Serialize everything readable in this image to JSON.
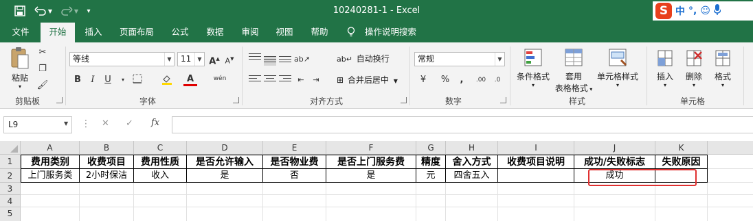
{
  "window": {
    "title": "10240281-1  -  Excel",
    "quick_access": {
      "save_icon": "save-icon",
      "undo_icon": "undo-icon",
      "redo_icon": "redo-icon",
      "customize_icon": "chevron-down-icon"
    }
  },
  "ime": {
    "logo": "S",
    "mode": "中",
    "punct": "°,",
    "emoji_icon": "smiley-icon",
    "mic_icon": "microphone-icon"
  },
  "tabs": [
    {
      "label": "文件"
    },
    {
      "label": "开始"
    },
    {
      "label": "插入"
    },
    {
      "label": "页面布局"
    },
    {
      "label": "公式"
    },
    {
      "label": "数据"
    },
    {
      "label": "审阅"
    },
    {
      "label": "视图"
    },
    {
      "label": "帮助"
    }
  ],
  "active_tab": "开始",
  "tell_me": {
    "label": "操作说明搜索",
    "icon": "lightbulb-icon"
  },
  "ribbon": {
    "clipboard": {
      "label": "剪贴板",
      "paste": "粘贴"
    },
    "font": {
      "label": "字体",
      "family": "等线",
      "size": "11",
      "bold": "B",
      "italic": "I",
      "underline": "U",
      "size_up": "A",
      "size_down": "A",
      "font_color": "A",
      "phonetic": "wén"
    },
    "alignment": {
      "label": "对齐方式",
      "wrap_text": "自动换行",
      "merge_center": "合并后居中"
    },
    "number": {
      "label": "数字",
      "format": "常规",
      "percent": "%",
      "comma": ",",
      "inc_decimal": ".00",
      "dec_decimal": ".0"
    },
    "styles": {
      "label": "样式",
      "conditional": "条件格式",
      "table_format_line1": "套用",
      "table_format_line2": "表格格式",
      "cell_styles": "单元格样式"
    },
    "cells": {
      "label": "单元格",
      "insert": "插入",
      "delete": "删除",
      "format": "格式"
    }
  },
  "formula_bar": {
    "name_box": "L9",
    "cancel": "✕",
    "enter": "✓",
    "fx": "fx",
    "value": ""
  },
  "sheet": {
    "columns": [
      "A",
      "B",
      "C",
      "D",
      "E",
      "F",
      "G",
      "H",
      "I",
      "J",
      "K"
    ],
    "rows": [
      "1",
      "2",
      "3",
      "4",
      "5"
    ],
    "header_row": [
      "费用类别",
      "收费项目",
      "费用性质",
      "是否允许输入",
      "是否物业费",
      "是否上门服务费",
      "精度",
      "舍入方式",
      "收费项目说明",
      "成功/失败标志",
      "失败原因"
    ],
    "data_row": [
      "上门服务类",
      "2小时保洁",
      "收入",
      "是",
      "否",
      "是",
      "元",
      "四舍五入",
      "",
      "成功",
      ""
    ]
  },
  "colors": {
    "brand": "#217346",
    "highlight_box": "#e03030"
  }
}
